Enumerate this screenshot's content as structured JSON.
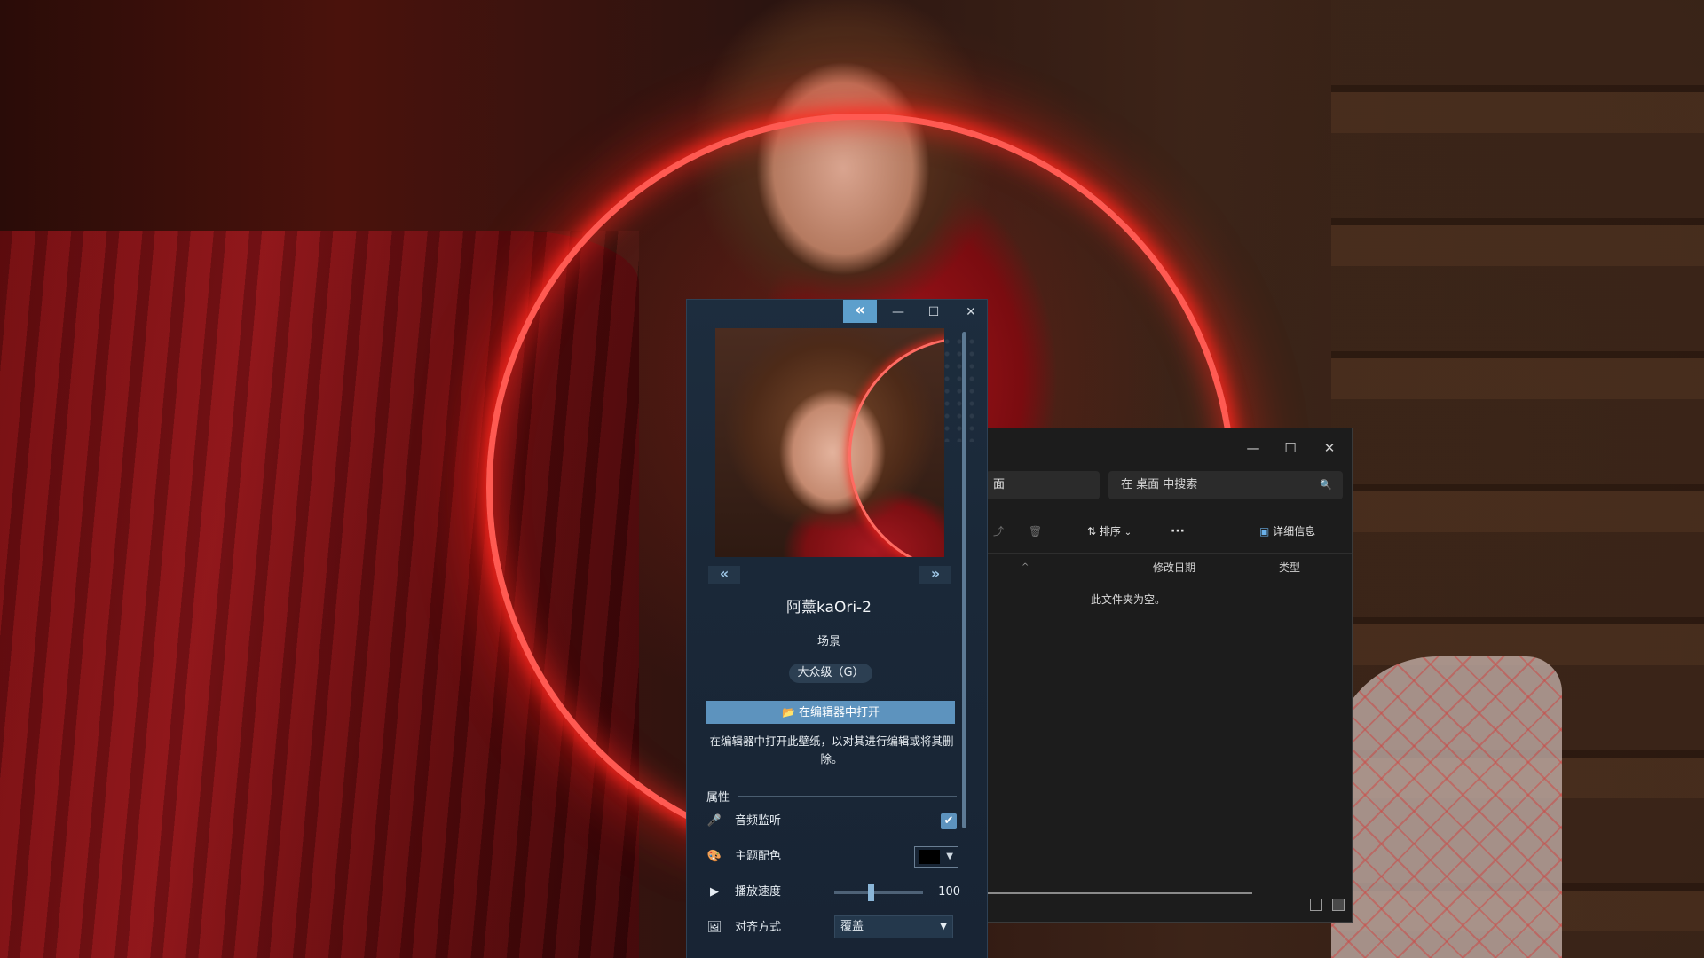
{
  "colors": {
    "accent": "#5d93be",
    "panel_bg": "#1a2838",
    "explorer_bg": "#1c1c1c",
    "ring_glow": "#ff3a30"
  },
  "explorer": {
    "address_fragment": "面",
    "search_placeholder": "在 桌面 中搜索",
    "toolbar": {
      "sort_label": "排序",
      "more_label": "···",
      "details_label": "详细信息"
    },
    "columns": [
      "修改日期",
      "类型"
    ],
    "empty_message": "此文件夹为空。",
    "icons": {
      "minimize": "—",
      "maximize": "☐",
      "close": "✕",
      "search": "🔍",
      "share": "⤴",
      "delete": "🗑",
      "sort": "⇅",
      "sort_chevron": "⌄",
      "details": "▣",
      "sort_indicator": "^"
    }
  },
  "wallpaper_panel": {
    "collapse_glyph": "«",
    "window_icons": {
      "minimize": "—",
      "maximize": "☐",
      "close": "✕"
    },
    "nav_prev": "«",
    "nav_next": "»",
    "title": "阿薰kaOri-2",
    "type": "场景",
    "rating": "大众级（G）",
    "open_editor_button": "在编辑器中打开",
    "open_editor_icon": "📂",
    "description": "在编辑器中打开此壁纸，以对其进行编辑或将其删除。",
    "properties_label": "属性",
    "properties": {
      "audio_monitor": {
        "label": "音频监听",
        "icon": "🎤",
        "checked": true,
        "check_glyph": "✔"
      },
      "theme_color": {
        "label": "主题配色",
        "icon": "🎨",
        "value": "#000000",
        "arrow": "▼"
      },
      "playback_speed": {
        "label": "播放速度",
        "icon": "▶",
        "value": "100",
        "slider_fraction": 0.38
      },
      "alignment": {
        "label": "对齐方式",
        "icon": "🖼",
        "value": "覆盖",
        "arrow": "▼"
      }
    }
  }
}
